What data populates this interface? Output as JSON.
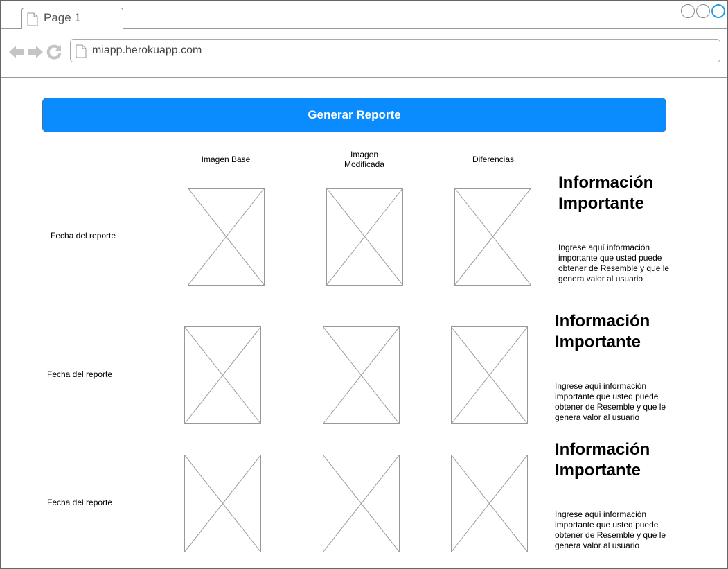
{
  "browser": {
    "tab_label": "Page 1",
    "url": "miapp.herokuapp.com"
  },
  "actions": {
    "generate_label": "Generar Reporte"
  },
  "columns": {
    "base": "Imagen Base",
    "modified": "Imagen\nModificada",
    "diff": "Diferencias"
  },
  "rows": [
    {
      "date_label": "Fecha del reporte",
      "info_title": "Información\nImportante",
      "info_text": "Ingrese aquí información importante que usted puede obtener de Resemble y que le genera valor al usuario"
    },
    {
      "date_label": "Fecha del reporte",
      "info_title": "Información\nImportante",
      "info_text": "Ingrese aquí información importante que usted puede obtener de Resemble y que le genera valor al usuario"
    },
    {
      "date_label": "Fecha del reporte",
      "info_title": "Información\nImportante",
      "info_text": "Ingrese aquí información importante que usted puede obtener de Resemble y que le genera valor al usuario"
    }
  ],
  "colors": {
    "accent": "#0a8cff",
    "window_active": "#2a9be8"
  }
}
